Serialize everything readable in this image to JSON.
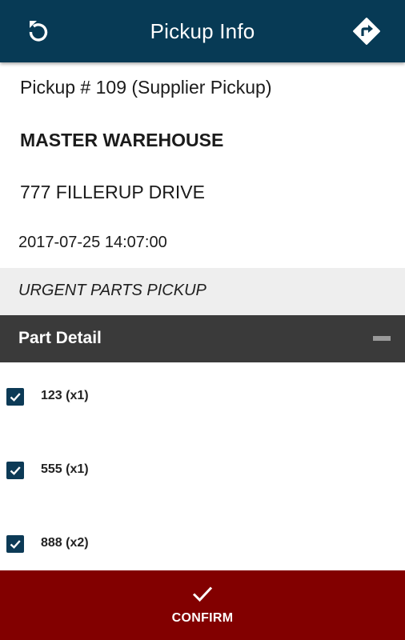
{
  "header": {
    "title": "Pickup Info",
    "back_icon": "refresh-back-icon",
    "directions_icon": "directions-icon"
  },
  "pickup": {
    "number": "Pickup # 109 (Supplier Pickup)",
    "location_name": "MASTER WAREHOUSE",
    "address": "777 FILLERUP DRIVE",
    "datetime": "2017-07-25 14:07:00",
    "note": "URGENT PARTS PICKUP"
  },
  "part_detail": {
    "title": "Part Detail",
    "collapse_icon": "minus-icon",
    "items": [
      {
        "label": "123 (x1)",
        "checked": true
      },
      {
        "label": "555 (x1)",
        "checked": true
      },
      {
        "label": "888 (x2)",
        "checked": true
      }
    ]
  },
  "footer": {
    "confirm_label": "CONFIRM",
    "confirm_icon": "check-icon"
  },
  "colors": {
    "header_bg": "#073a55",
    "section_header_bg": "#3a3a3a",
    "note_bg": "#eeeeee",
    "checkbox": "#0c3a56",
    "confirm_bg": "#820000"
  }
}
